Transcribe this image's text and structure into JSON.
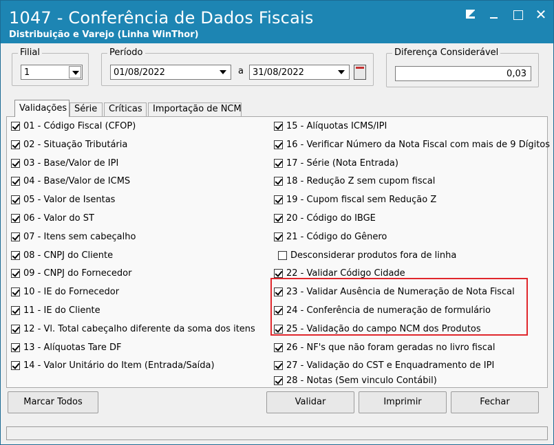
{
  "window": {
    "title": "1047 - Conferência de Dados Fiscais",
    "subtitle": "Distribuição e Varejo (Linha WinThor)"
  },
  "filters": {
    "filial_label": "Filial",
    "filial_value": "1",
    "periodo_label": "Período",
    "date_from": "01/08/2022",
    "date_sep": "a",
    "date_to": "31/08/2022",
    "diferenca_label": "Diferença Considerável",
    "diferenca_value": "0,03"
  },
  "tabs": [
    {
      "label": "Validações",
      "active": true
    },
    {
      "label": "Série",
      "active": false
    },
    {
      "label": "Críticas",
      "active": false
    },
    {
      "label": "Importação de NCM",
      "active": false
    }
  ],
  "validations_left": [
    {
      "label": "01 - Código Fiscal (CFOP)",
      "checked": true
    },
    {
      "label": "02 - Situação Tributária",
      "checked": true
    },
    {
      "label": "03 - Base/Valor de IPI",
      "checked": true
    },
    {
      "label": "04 - Base/Valor de ICMS",
      "checked": true
    },
    {
      "label": "05 - Valor de Isentas",
      "checked": true
    },
    {
      "label": "06 - Valor do ST",
      "checked": true
    },
    {
      "label": "07 - Itens sem cabeçalho",
      "checked": true
    },
    {
      "label": "08 - CNPJ do Cliente",
      "checked": true
    },
    {
      "label": "09 - CNPJ do Fornecedor",
      "checked": true
    },
    {
      "label": "10 - IE do Fornecedor",
      "checked": true
    },
    {
      "label": "11 - IE do Cliente",
      "checked": true
    },
    {
      "label": "12 - Vl. Total cabeçalho diferente da soma dos itens",
      "checked": true
    },
    {
      "label": "13 - Alíquotas Tare DF",
      "checked": true
    },
    {
      "label": "14 - Valor Unitário do Item (Entrada/Saída)",
      "checked": true
    }
  ],
  "validations_right": [
    {
      "label": "15 - Alíquotas ICMS/IPI",
      "checked": true
    },
    {
      "label": "16 - Verificar Número da Nota Fiscal com mais de 9 Dígitos",
      "checked": true
    },
    {
      "label": "17 - Série (Nota Entrada)",
      "checked": true
    },
    {
      "label": "18 - Redução Z sem cupom fiscal",
      "checked": true
    },
    {
      "label": "19 - Cupom fiscal sem Redução Z",
      "checked": true
    },
    {
      "label": "20 - Código do IBGE",
      "checked": true
    },
    {
      "label": "21 - Código do Gênero",
      "checked": true
    },
    {
      "label": "Desconsiderar produtos fora de linha",
      "checked": false
    },
    {
      "label": "22 - Validar Código Cidade",
      "checked": true
    },
    {
      "label": "23 - Validar Ausência de Numeração de Nota Fiscal",
      "checked": true
    },
    {
      "label": "24 - Conferência de numeração de formulário",
      "checked": true
    },
    {
      "label": "25 - Validação do campo NCM dos Produtos",
      "checked": true
    },
    {
      "label": "26 - NF's que não foram geradas no livro fiscal",
      "checked": true
    },
    {
      "label": "27 - Validação do CST e Enquadramento de IPI",
      "checked": true
    },
    {
      "label": "28 - Notas (Sem vinculo Contábil)",
      "checked": true
    }
  ],
  "buttons": {
    "marcar_todos": "Marcar Todos",
    "validar": "Validar",
    "imprimir": "Imprimir",
    "fechar": "Fechar"
  },
  "colors": {
    "titlebar": "#1d85b3",
    "highlight": "#e0262b"
  }
}
